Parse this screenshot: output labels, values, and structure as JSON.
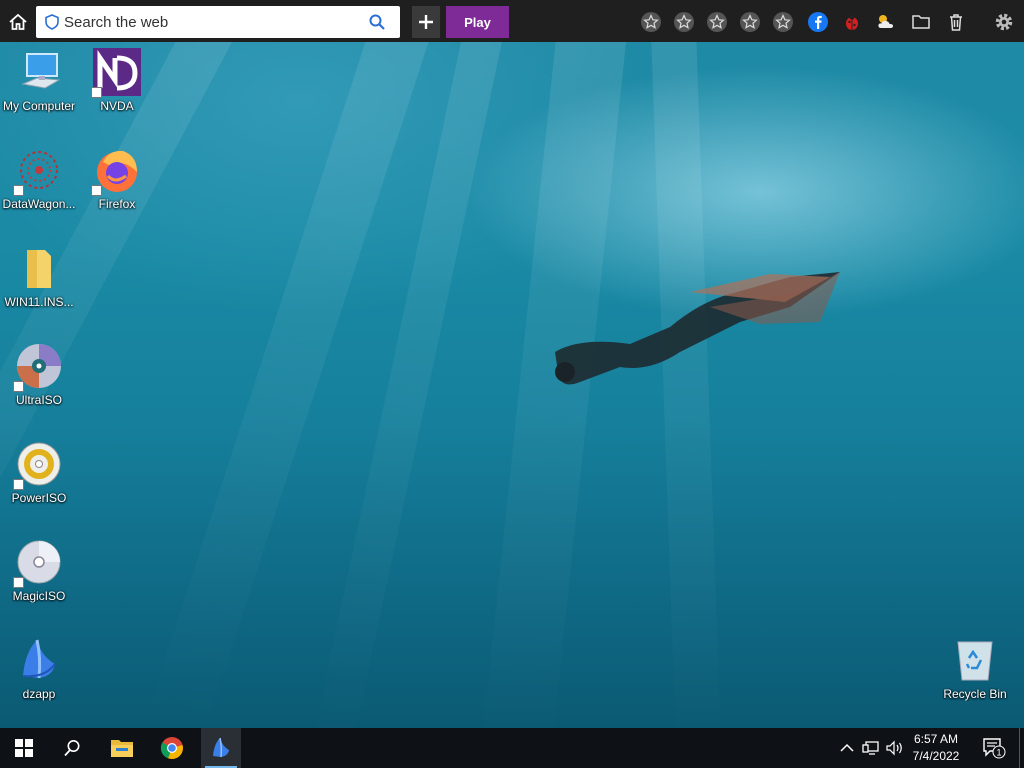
{
  "toolbar": {
    "search_placeholder": "Search the web",
    "play_label": "Play",
    "icons": [
      "home-icon",
      "shield-icon",
      "search-icon",
      "plus-icon",
      "star-icon",
      "star-icon",
      "star-icon",
      "star-icon",
      "star-icon",
      "facebook-icon",
      "ladybug-icon",
      "weather-icon",
      "folder-icon",
      "trash-icon",
      "gear-icon"
    ]
  },
  "desktop_icons": [
    {
      "label": "My Computer",
      "icon": "computer-icon"
    },
    {
      "label": "NVDA",
      "icon": "nvda-icon"
    },
    {
      "label": "DataWagon...",
      "icon": "datawagon-icon"
    },
    {
      "label": "Firefox",
      "icon": "firefox-icon"
    },
    {
      "label": "WIN11.INS...",
      "icon": "folder-icon"
    },
    {
      "label": "UltraISO",
      "icon": "ultraiso-icon"
    },
    {
      "label": "PowerISO",
      "icon": "poweriso-icon"
    },
    {
      "label": "MagicISO",
      "icon": "magiciso-icon"
    },
    {
      "label": "dzapp",
      "icon": "dzapp-icon"
    },
    {
      "label": "Recycle Bin",
      "icon": "recycle-bin-icon"
    }
  ],
  "taskbar": {
    "time": "6:57 AM",
    "date": "7/4/2022",
    "notification_count": "1",
    "accent": "#76b9ed"
  }
}
